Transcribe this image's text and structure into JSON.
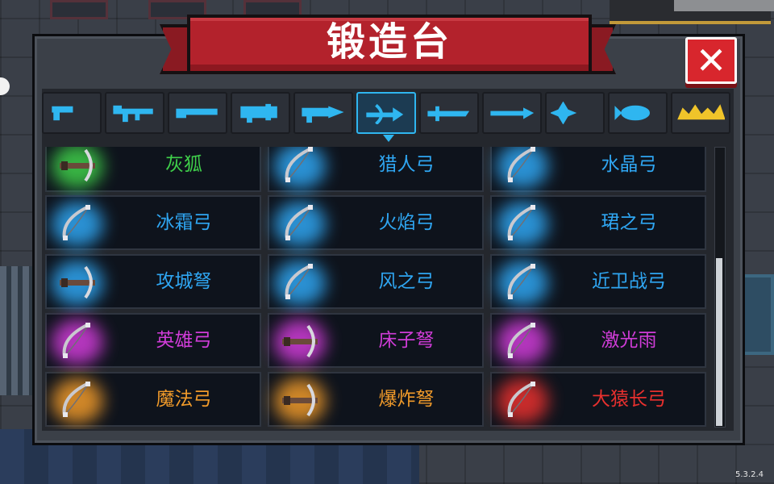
{
  "title": "锻造台",
  "close_icon": "close-x-icon",
  "version": "5.3.2.4",
  "tabs": [
    {
      "icon": "pistol-icon",
      "active": false
    },
    {
      "icon": "rifle-icon",
      "active": false
    },
    {
      "icon": "shotgun-icon",
      "active": false
    },
    {
      "icon": "launcher-icon",
      "active": false
    },
    {
      "icon": "drill-gun-icon",
      "active": false
    },
    {
      "icon": "bow-icon",
      "active": true
    },
    {
      "icon": "sword-icon",
      "active": false
    },
    {
      "icon": "spear-icon",
      "active": false
    },
    {
      "icon": "shuriken-icon",
      "active": false
    },
    {
      "icon": "fish-icon",
      "active": false
    },
    {
      "icon": "crown-special-icon",
      "active": false
    }
  ],
  "colors": {
    "tab_icon": "#2fb6f0",
    "tab_icon_special": "#f0c42a",
    "green": "#3fcf4a",
    "blue": "#2fa6f2",
    "purple": "#d03cd8",
    "orange": "#f09a2a",
    "red": "#e8302e"
  },
  "items": [
    {
      "name": "灰狐",
      "rarity": "green",
      "icon": "crossbow-icon"
    },
    {
      "name": "猎人弓",
      "rarity": "blue",
      "icon": "bow-icon"
    },
    {
      "name": "水晶弓",
      "rarity": "blue",
      "icon": "bow-icon"
    },
    {
      "name": "冰霜弓",
      "rarity": "blue",
      "icon": "bow-icon"
    },
    {
      "name": "火焰弓",
      "rarity": "blue",
      "icon": "bow-icon"
    },
    {
      "name": "珺之弓",
      "rarity": "blue",
      "icon": "bow-icon"
    },
    {
      "name": "攻城弩",
      "rarity": "blue",
      "icon": "crossbow-icon"
    },
    {
      "name": "风之弓",
      "rarity": "blue",
      "icon": "bow-icon"
    },
    {
      "name": "近卫战弓",
      "rarity": "blue",
      "icon": "bow-icon"
    },
    {
      "name": "英雄弓",
      "rarity": "purple",
      "icon": "bow-icon"
    },
    {
      "name": "床子弩",
      "rarity": "purple",
      "icon": "crossbow-icon"
    },
    {
      "name": "激光雨",
      "rarity": "purple",
      "icon": "bow-icon"
    },
    {
      "name": "魔法弓",
      "rarity": "orange",
      "icon": "bow-icon"
    },
    {
      "name": "爆炸弩",
      "rarity": "orange",
      "icon": "crossbow-icon"
    },
    {
      "name": "大猿长弓",
      "rarity": "red",
      "icon": "bow-icon"
    }
  ]
}
